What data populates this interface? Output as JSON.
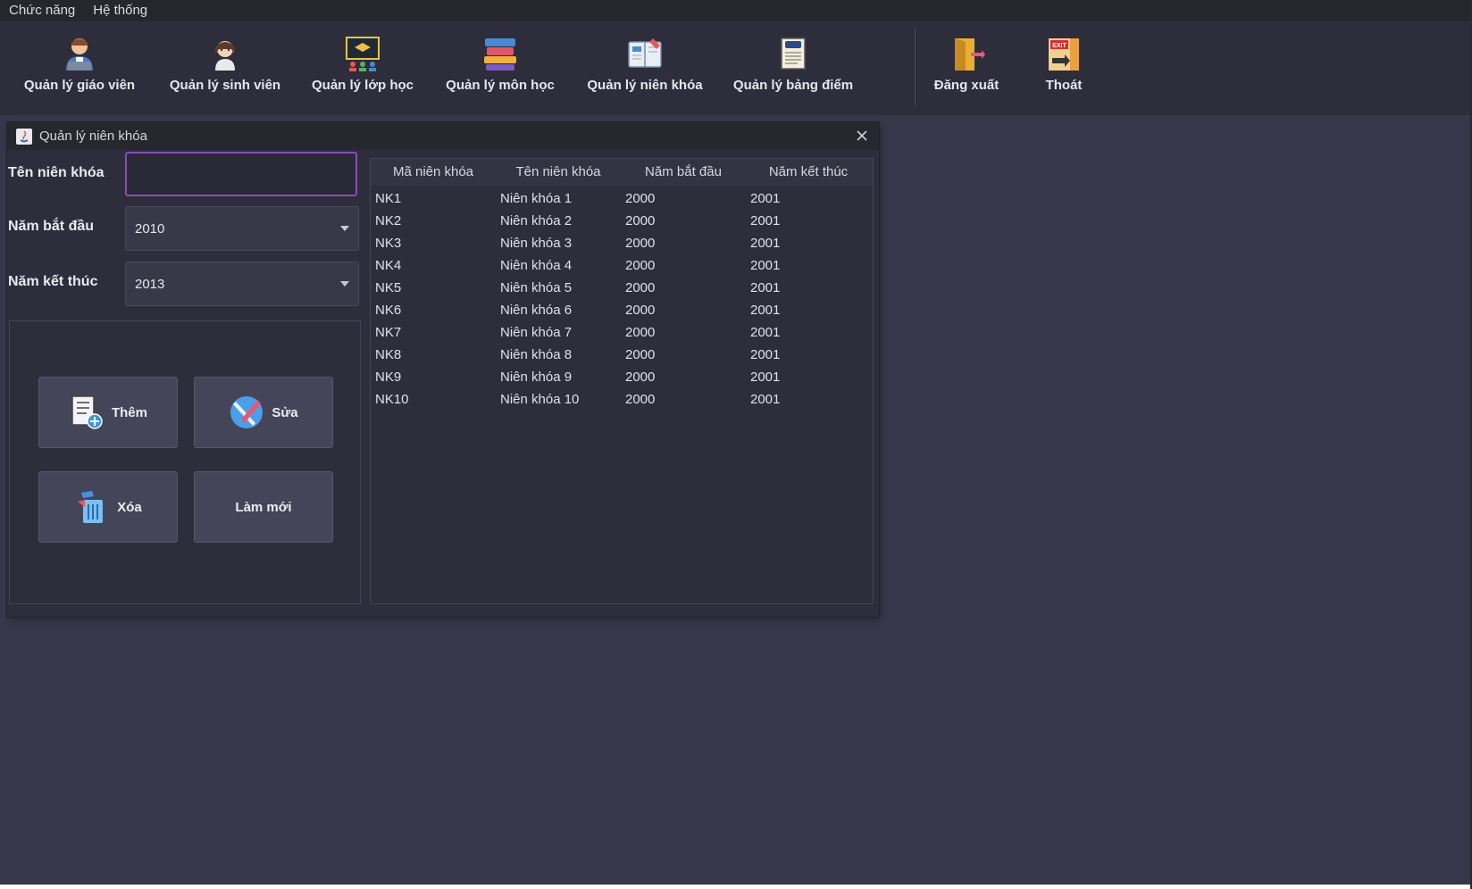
{
  "menu": {
    "items": [
      "Chức năng",
      "Hệ thống"
    ]
  },
  "toolbar": {
    "buttons": [
      {
        "label": "Quản lý giáo viên",
        "icon": "teacher-icon"
      },
      {
        "label": "Quản lý sinh viên",
        "icon": "student-icon"
      },
      {
        "label": "Quản lý lớp học",
        "icon": "classroom-icon"
      },
      {
        "label": "Quản lý môn học",
        "icon": "books-icon"
      },
      {
        "label": "Quản lý niên khóa",
        "icon": "course-year-icon"
      },
      {
        "label": "Quản lý bảng điểm",
        "icon": "transcript-icon"
      },
      {
        "label": "Đăng xuất",
        "icon": "logout-door-icon"
      },
      {
        "label": "Thoát",
        "icon": "exit-icon"
      }
    ]
  },
  "window": {
    "title": "Quản lý niên khóa",
    "form": {
      "name_label": "Tên niên khóa",
      "name_value": "",
      "start_label": "Năm bắt đầu",
      "start_value": "2010",
      "end_label": "Năm kết thúc",
      "end_value": "2013"
    },
    "actions": {
      "add": "Thêm",
      "edit": "Sửa",
      "delete": "Xóa",
      "refresh": "Làm mới"
    },
    "table": {
      "headers": [
        "Mã niên khóa",
        "Tên niên khóa",
        "Năm bắt đầu",
        "Năm kết thúc"
      ],
      "rows": [
        [
          "NK1",
          "Niên khóa 1",
          "2000",
          "2001"
        ],
        [
          "NK2",
          "Niên khóa 2",
          "2000",
          "2001"
        ],
        [
          "NK3",
          "Niên khóa 3",
          "2000",
          "2001"
        ],
        [
          "NK4",
          "Niên khóa 4",
          "2000",
          "2001"
        ],
        [
          "NK5",
          "Niên khóa 5",
          "2000",
          "2001"
        ],
        [
          "NK6",
          "Niên khóa 6",
          "2000",
          "2001"
        ],
        [
          "NK7",
          "Niên khóa 7",
          "2000",
          "2001"
        ],
        [
          "NK8",
          "Niên khóa 8",
          "2000",
          "2001"
        ],
        [
          "NK9",
          "Niên khóa 9",
          "2000",
          "2001"
        ],
        [
          "NK10",
          "Niên khóa 10",
          "2000",
          "2001"
        ]
      ]
    }
  },
  "colors": {
    "desktop_bg": "#37374b",
    "toolbar_bg": "#2d2d3b",
    "focus_border": "#8a4bb8"
  }
}
